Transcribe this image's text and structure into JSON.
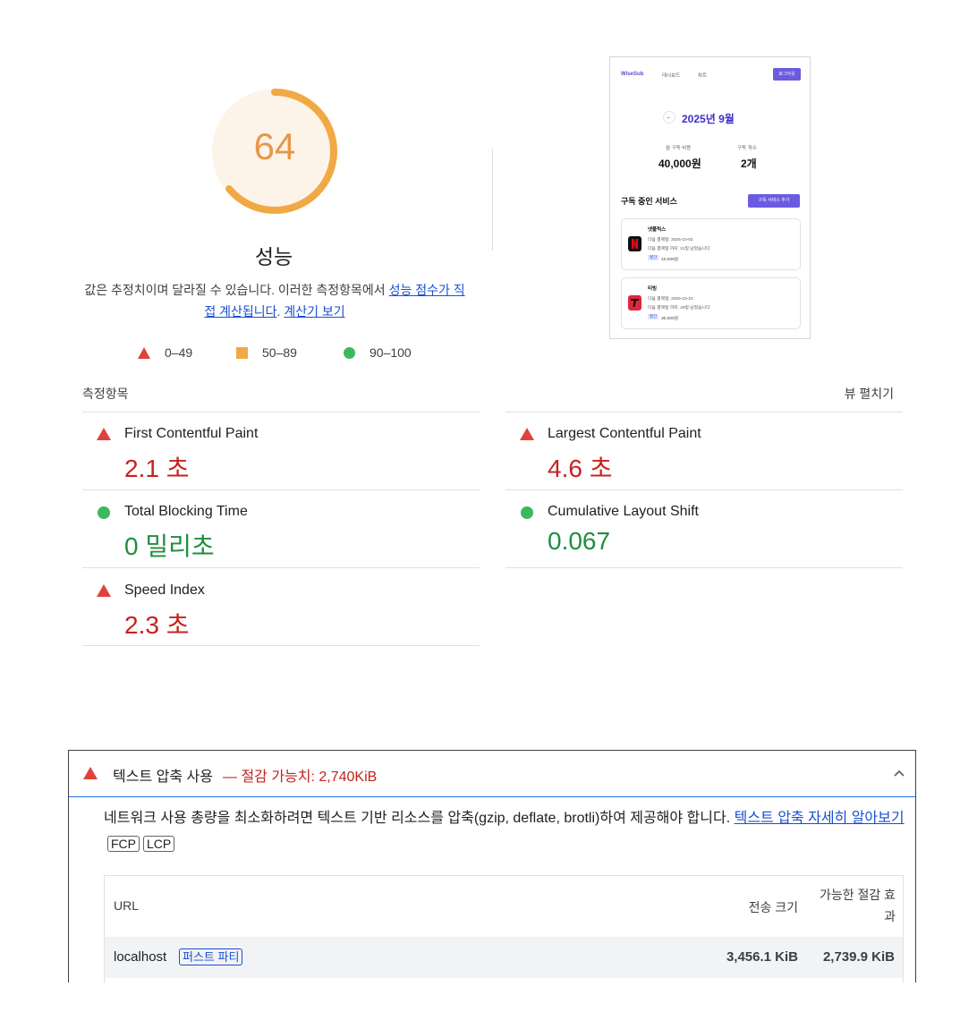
{
  "score": {
    "value": "64",
    "fraction": 0.64,
    "title": "성능",
    "color": "#f0a945"
  },
  "description": {
    "text": "값은 추정치이며 달라질 수 있습니다. 이러한 측정항목에서 ",
    "link1": "성능 점수가 직접 계산됩니다",
    "separator": ". ",
    "link2": "계산기 보기"
  },
  "legend": [
    {
      "icon": "red-triangle-icon",
      "label": "0–49"
    },
    {
      "icon": "orange-square-icon",
      "label": "50–89"
    },
    {
      "icon": "green-circle-icon",
      "label": "90–100"
    }
  ],
  "preview": {
    "brand": "WiseSub",
    "nav": [
      "대시보드",
      "차트"
    ],
    "logout": "로그아웃",
    "back_icon": "arrow-left-icon",
    "month": "2025년 9월",
    "cost_label": "월 구독 비용",
    "cost_value": "40,000원",
    "count_label": "구독 개수",
    "count_value": "2개",
    "section_title": "구독 중인 서비스",
    "add_button": "구독 서비스 추가",
    "cards": [
      {
        "name": "넷플릭스",
        "line1": "다음 결제일: 2025-10-02",
        "line2": "다음 결제일 까지: 21일 남았습니다",
        "badge": "월간",
        "price": "10,000원",
        "logo_color": "#e50914"
      },
      {
        "name": "티빙",
        "line1": "다음 결제일: 2025-10-10",
        "line2": "다음 결제일 까지: 29일 남았습니다",
        "badge": "월간",
        "price": "30,000원",
        "logo_color": "#e3243b"
      }
    ]
  },
  "metrics": {
    "label": "측정항목",
    "expand": "뷰 펼치기",
    "items": [
      {
        "name": "First Contentful Paint",
        "value": "2.1 초",
        "status": "fail"
      },
      {
        "name": "Largest Contentful Paint",
        "value": "4.6 초",
        "status": "fail"
      },
      {
        "name": "Total Blocking Time",
        "value": "0 밀리초",
        "status": "pass"
      },
      {
        "name": "Cumulative Layout Shift",
        "value": "0.067",
        "status": "pass"
      },
      {
        "name": "Speed Index",
        "value": "2.3 초",
        "status": "fail"
      }
    ]
  },
  "audit": {
    "title": "텍스트 압축 사용",
    "savings": "— 절감 가능치: 2,740KiB",
    "description": "네트워크 사용 총량을 최소화하려면 텍스트 기반 리소스를 압축(gzip, deflate, brotli)하여 제공해야 합니다. ",
    "link": "텍스트 압축 자세히 알아보기",
    "chips": [
      "FCP",
      "LCP"
    ],
    "table": {
      "headers": [
        "URL",
        "전송 크기",
        "가능한 절감 효과"
      ],
      "rows": [
        {
          "url": "localhost",
          "badge": "퍼스트 파티",
          "size": "3,456.1 KiB",
          "savings": "2,739.9 KiB"
        }
      ]
    }
  },
  "colors": {
    "fail": "#c5221f",
    "pass": "#1e8e3e",
    "average": "#f0a945",
    "link": "#1a4fd0"
  }
}
